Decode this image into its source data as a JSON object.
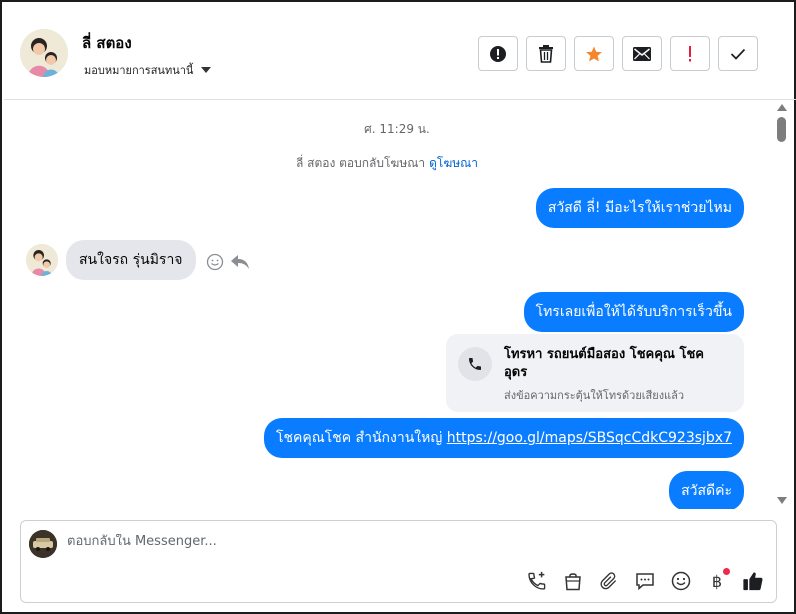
{
  "header": {
    "contact_name": "ลี่ สตอง",
    "assign_label": "มอบหมายการสนทนานี้",
    "actions": [
      {
        "icon": "alert-circle-icon"
      },
      {
        "icon": "trash-icon"
      },
      {
        "icon": "star-icon"
      },
      {
        "icon": "envelope-icon"
      },
      {
        "icon": "exclamation-icon"
      },
      {
        "icon": "check-icon"
      }
    ]
  },
  "thread": {
    "timestamp": "ศ. 11:29 น.",
    "ad_reply_text": "ลี่ สตอง ตอบกลับโฆษณา",
    "ad_link": "ดูโฆษณา",
    "messages": [
      {
        "from": "page",
        "text": "สวัสดี ลี่! มีอะไรให้เราช่วยไหม"
      },
      {
        "from": "contact",
        "text": "สนใจรถ รุ่นมิราจ"
      },
      {
        "from": "page",
        "text": "โทรเลยเพื่อให้ได้รับบริการเร็วขึ้น"
      },
      {
        "from": "page",
        "text": "โชคคุณโชค สำนักงานใหญ่ ",
        "link": "https://goo.gl/maps/SBSqcCdkC923sjbx7"
      },
      {
        "from": "page",
        "text": "สวัสดีค่ะ"
      }
    ],
    "call_card": {
      "title": "โทรหา รถยนต์มือสอง โชคคุณ โชค อุดร",
      "subtitle": "ส่งข้อความกระตุ้นให้โทรด้วยเสียงแล้ว"
    }
  },
  "composer": {
    "placeholder": "ตอบกลับใน Messenger...",
    "tools": [
      "call-plus-icon",
      "shopping-bag-icon",
      "paperclip-icon",
      "saved-reply-icon",
      "emoji-icon",
      "baht-icon",
      "thumbs-up-icon"
    ],
    "baht_symbol": "฿"
  },
  "colors": {
    "outgoing_bubble": "#0a7cff",
    "incoming_bubble": "#e4e6eb",
    "star": "#f5862e",
    "exclamation": "#e41e3f",
    "link": "#0064d1"
  }
}
